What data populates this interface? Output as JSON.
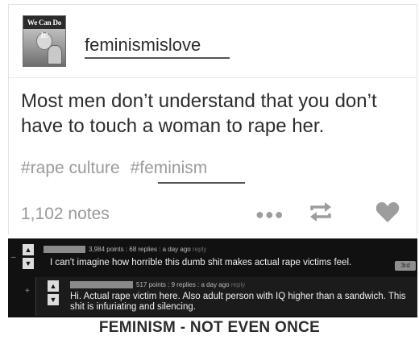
{
  "post": {
    "avatar_text": "We Can Do It!",
    "username": "feminismislove",
    "body": "Most men don’t understand that you don’t have to touch a woman to rape her.",
    "tags": [
      "#rape culture",
      "#feminism"
    ],
    "notes": "1,102 notes",
    "icons": {
      "more": "more-dots-icon",
      "reblog": "reblog-icon",
      "like": "heart-icon"
    }
  },
  "comments": [
    {
      "meta_prefix": "3,984 points : 68 replies : a day ago",
      "reply": "reply",
      "text": "I can't imagine how horrible this dumb shit makes actual rape victims feel.",
      "badge": "3rd"
    },
    {
      "meta_prefix": "517 points : 9 replies : a day ago",
      "reply": "reply",
      "text": "Hi. Actual rape victim here. Also adult person with IQ higher than a sandwich. This shit is infuriating and silencing."
    }
  ],
  "caption": "FEMINISM - NOT EVEN ONCE",
  "colors": {
    "comment_bg": "#111111",
    "tag": "#9b9b9b",
    "icon": "#9d9d9d"
  }
}
